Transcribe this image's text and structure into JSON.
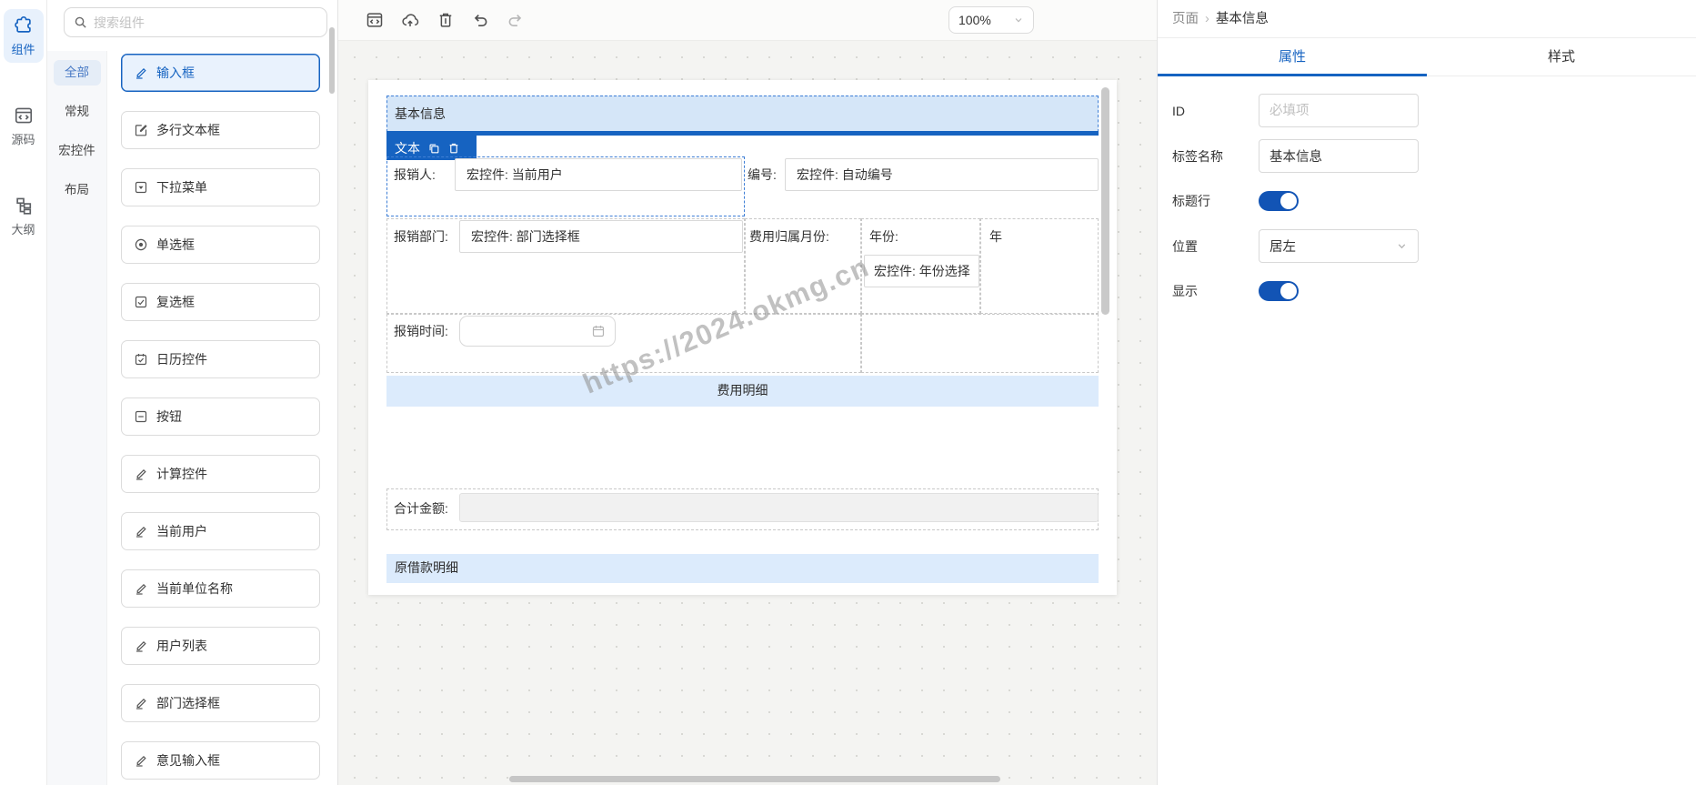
{
  "rail": {
    "items": [
      {
        "label": "组件",
        "icon": "puzzle-icon",
        "active": true
      },
      {
        "label": "源码",
        "icon": "code-window-icon",
        "active": false
      },
      {
        "label": "大纲",
        "icon": "outline-tree-icon",
        "active": false
      }
    ]
  },
  "library": {
    "search_placeholder": "搜索组件",
    "categories": [
      {
        "label": "全部",
        "active": true
      },
      {
        "label": "常规",
        "active": false
      },
      {
        "label": "宏控件",
        "active": false
      },
      {
        "label": "布局",
        "active": false
      }
    ],
    "components": [
      {
        "label": "输入框",
        "icon": "pencil-icon",
        "selected": true
      },
      {
        "label": "多行文本框",
        "icon": "textarea-icon",
        "selected": false
      },
      {
        "label": "下拉菜单",
        "icon": "dropdown-icon",
        "selected": false
      },
      {
        "label": "单选框",
        "icon": "radio-icon",
        "selected": false
      },
      {
        "label": "复选框",
        "icon": "checkbox-icon",
        "selected": false
      },
      {
        "label": "日历控件",
        "icon": "calendar-check-icon",
        "selected": false
      },
      {
        "label": "按钮",
        "icon": "button-square-icon",
        "selected": false
      },
      {
        "label": "计算控件",
        "icon": "pencil-icon",
        "selected": false
      },
      {
        "label": "当前用户",
        "icon": "pencil-icon",
        "selected": false
      },
      {
        "label": "当前单位名称",
        "icon": "pencil-icon",
        "selected": false
      },
      {
        "label": "用户列表",
        "icon": "pencil-icon",
        "selected": false
      },
      {
        "label": "部门选择框",
        "icon": "pencil-icon",
        "selected": false
      },
      {
        "label": "意见输入框",
        "icon": "pencil-icon",
        "selected": false
      }
    ]
  },
  "canvas": {
    "toolbar_icons": [
      "code-window-icon",
      "cloud-upload-icon",
      "trash-icon",
      "undo-icon",
      "redo-icon"
    ],
    "zoom_value": "100%",
    "form": {
      "header_label": "基本信息",
      "selected_tag_label": "文本",
      "fields": {
        "reimburser_label": "报销人:",
        "reimburser_value": "宏控件: 当前用户",
        "number_label": "编号:",
        "number_value": "宏控件: 自动编号",
        "department_label": "报销部门:",
        "department_value": "宏控件: 部门选择框",
        "month_label": "费用归属月份:",
        "year_label": "年份:",
        "year_value": "宏控件: 年份选择",
        "year_suffix": "年",
        "time_label": "报销时间:",
        "total_label": "合计金额:"
      },
      "sections": {
        "fee_detail": "费用明细",
        "loan_detail": "原借款明细"
      },
      "watermark": "https://2024.okmg.cn"
    }
  },
  "inspector": {
    "breadcrumb": {
      "parent": "页面",
      "separator": "›",
      "current": "基本信息"
    },
    "tabs": [
      {
        "label": "属性",
        "active": true
      },
      {
        "label": "样式",
        "active": false
      }
    ],
    "fields": [
      {
        "label": "ID",
        "type": "input",
        "placeholder": "必填项",
        "value": ""
      },
      {
        "label": "标签名称",
        "type": "input",
        "value": "基本信息"
      },
      {
        "label": "标题行",
        "type": "toggle",
        "value": "on"
      },
      {
        "label": "位置",
        "type": "select",
        "value": "居左"
      },
      {
        "label": "显示",
        "type": "toggle",
        "value": "on"
      }
    ]
  },
  "colors": {
    "primary": "#1663c1",
    "selection_dash": "#3f7fd6",
    "header_fill": "#d5e6f8",
    "band_fill": "#dcebfc"
  }
}
